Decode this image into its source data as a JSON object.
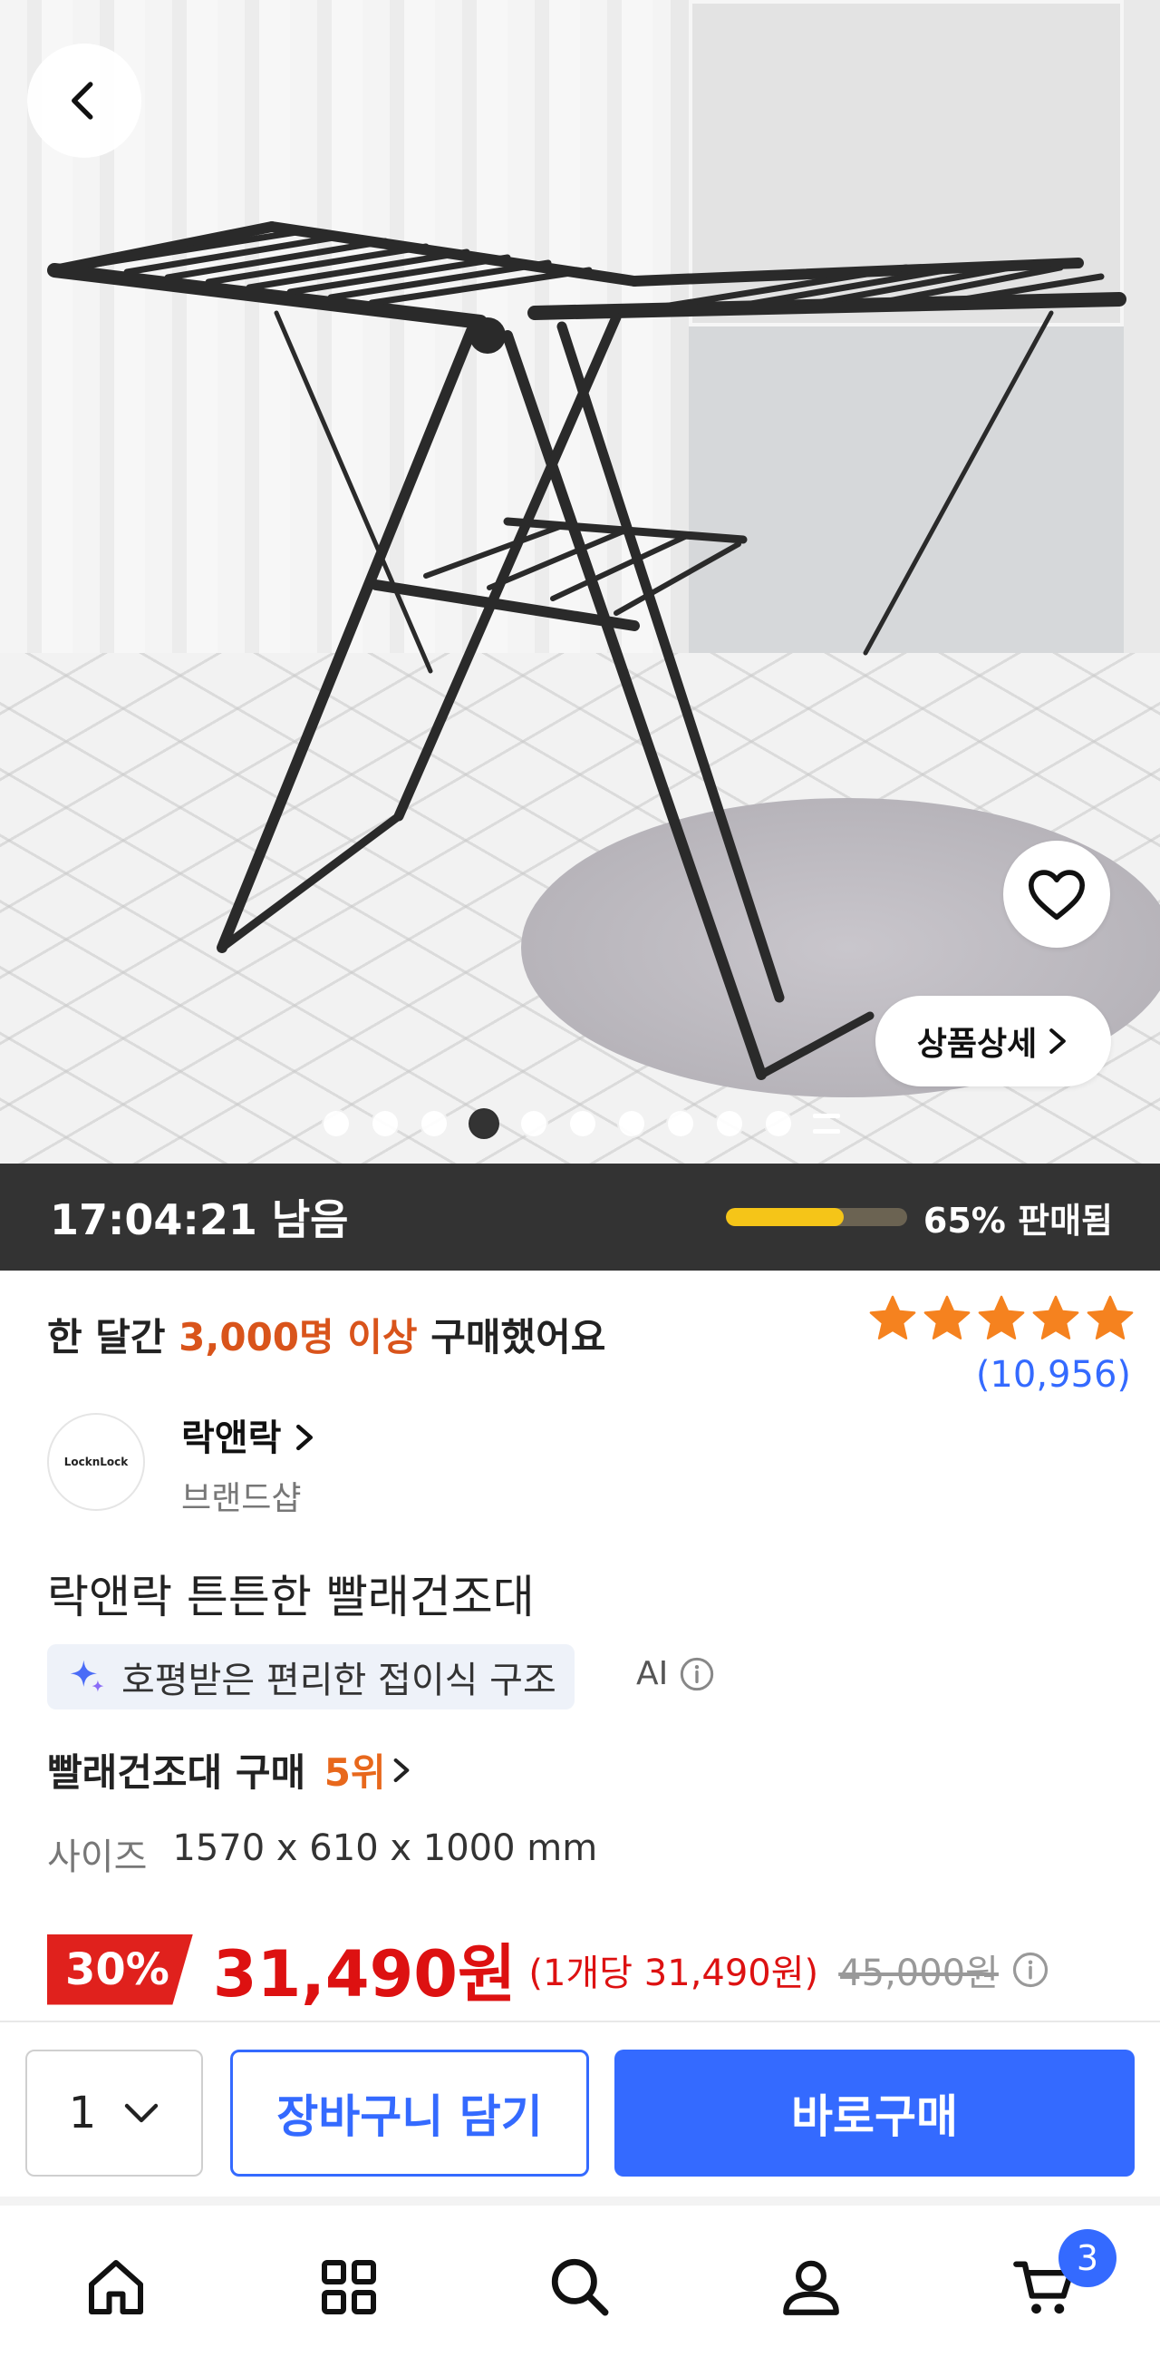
{
  "hero": {
    "back_icon": "chevron-left-icon",
    "heart_icon": "heart-icon",
    "detail_label": "상품상세",
    "detail_icon": "chevron-right-icon",
    "slide_count": 10,
    "active_slide": 4
  },
  "timer": {
    "remaining": "17:04:21 남음",
    "sold_percent": 65,
    "sold_label": "65% 판매됨"
  },
  "info": {
    "purchase_prefix": "한 달간 ",
    "purchase_highlight": "3,000명 이상",
    "purchase_suffix": " 구매했어요",
    "rating": 5,
    "review_count": "(10,956)",
    "brand_logo_text": "LocknLock",
    "brand_name": "락앤락",
    "brand_shop": "브랜드샵",
    "product_title": "락앤락 튼튼한 빨래건조대",
    "ai_summary": "호평받은 편리한 접이식 구조",
    "ai_label": "AI",
    "rank_prefix": "빨래건조대 구매 ",
    "rank_value": "5위",
    "size_label": "사이즈",
    "size_value": "1570 x 610 x 1000 mm",
    "discount": "30%",
    "price": "31,490원",
    "unit_price": "(1개당 31,490원)",
    "original_price": "45,000원"
  },
  "actions": {
    "quantity": "1",
    "add_to_cart": "장바구니 담기",
    "buy_now": "바로구매"
  },
  "nav": {
    "items": [
      "home-icon",
      "categories-icon",
      "search-icon",
      "my-page-icon",
      "cart-icon"
    ],
    "cart_badge": "3"
  },
  "colors": {
    "accent": "#346aff",
    "price_red": "#dd1111",
    "highlight_orange": "#d9541b",
    "star": "#f5821f",
    "timer_bg": "#333333",
    "progress": "#f5c518"
  }
}
